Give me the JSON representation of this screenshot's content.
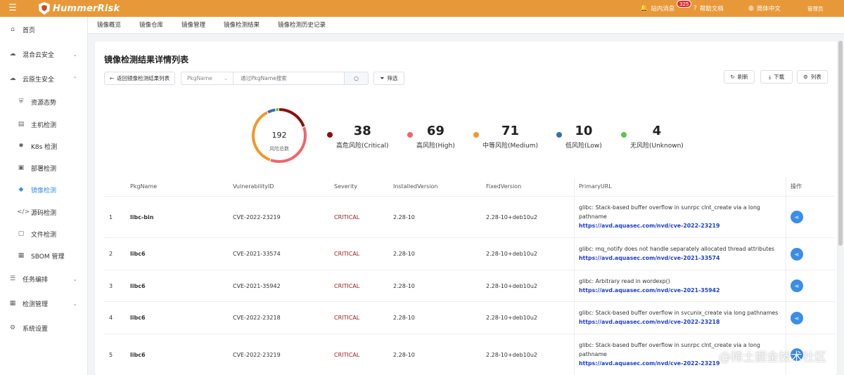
{
  "app": {
    "brand": "HummerRisk"
  },
  "header": {
    "messages_label": "站内消息",
    "messages_badge": "325",
    "help_label": "帮助文档",
    "language_label": "简体中文",
    "user_label": "管理员",
    "accent_color": "#e7993a"
  },
  "sidebar": {
    "items": [
      {
        "label": "首页",
        "icon": "home-icon"
      },
      {
        "label": "混合云安全",
        "icon": "cloud-icon"
      },
      {
        "label": "云原生安全",
        "icon": "cloud-native-icon"
      },
      {
        "label": "资源态势",
        "icon": "shield-icon"
      },
      {
        "label": "主机检测",
        "icon": "server-icon"
      },
      {
        "label": "K8s 检测",
        "icon": "k8s-icon"
      },
      {
        "label": "部署检测",
        "icon": "deploy-icon"
      },
      {
        "label": "镜像检测",
        "icon": "image-icon"
      },
      {
        "label": "源码检测",
        "icon": "code-icon"
      },
      {
        "label": "文件检测",
        "icon": "file-icon"
      },
      {
        "label": "SBOM 管理",
        "icon": "sbom-icon"
      },
      {
        "label": "任务编排",
        "icon": "list-icon"
      },
      {
        "label": "检测管理",
        "icon": "grid-icon"
      },
      {
        "label": "系统设置",
        "icon": "gear-icon"
      }
    ]
  },
  "tabs": [
    "镜像概览",
    "镜像仓库",
    "镜像管理",
    "镜像检测结果",
    "镜像检测历史记录"
  ],
  "main": {
    "title": "镜像检测结果详情列表",
    "back_label": "返回镜像检测结果列表",
    "select_value": "PkgName",
    "search_placeholder": "通过PkgName搜索",
    "filter_label": "筛选",
    "refresh_label": "刷新",
    "download_label": "下载",
    "columns_label": "列表"
  },
  "summary": {
    "total": "192",
    "total_label": "风险总数",
    "stats": [
      {
        "value": "38",
        "label": "高危风险(Critical)",
        "color": "#8b0f0f"
      },
      {
        "value": "69",
        "label": "高风险(High)",
        "color": "#f0646c"
      },
      {
        "value": "71",
        "label": "中等风险(Medium)",
        "color": "#f5962a"
      },
      {
        "value": "10",
        "label": "低风险(Low)",
        "color": "#3d6ea8"
      },
      {
        "value": "4",
        "label": "无风险(Unknown)",
        "color": "#5fc24c"
      }
    ]
  },
  "table": {
    "headers": [
      "PkgName",
      "VulnerabilityID",
      "Severity",
      "InstalledVersion",
      "FixedVersion",
      "PrimaryURL",
      "操作"
    ],
    "rows": [
      {
        "index": "1",
        "pkg": "libc-bin",
        "vuln": "CVE-2022-23219",
        "severity": "CRITICAL",
        "installed": "2.28-10",
        "fixed": "2.28-10+deb10u2",
        "desc": "glibc: Stack-based buffer overflow in sunrpc clnt_create via a long pathname",
        "url": "https://avd.aquasec.com/nvd/cve-2022-23219"
      },
      {
        "index": "2",
        "pkg": "libc6",
        "vuln": "CVE-2021-33574",
        "severity": "CRITICAL",
        "installed": "2.28-10",
        "fixed": "2.28-10+deb10u2",
        "desc": "glibc: mq_notify does not handle separately allocated thread attributes",
        "url": "https://avd.aquasec.com/nvd/cve-2021-33574"
      },
      {
        "index": "3",
        "pkg": "libc6",
        "vuln": "CVE-2021-35942",
        "severity": "CRITICAL",
        "installed": "2.28-10",
        "fixed": "2.28-10+deb10u2",
        "desc": "glibc: Arbitrary read in wordexp()",
        "url": "https://avd.aquasec.com/nvd/cve-2021-35942"
      },
      {
        "index": "4",
        "pkg": "libc6",
        "vuln": "CVE-2022-23218",
        "severity": "CRITICAL",
        "installed": "2.28-10",
        "fixed": "2.28-10+deb10u2",
        "desc": "glibc: Stack-based buffer overflow in svcunix_create via long pathnames",
        "url": "https://avd.aquasec.com/nvd/cve-2022-23218"
      },
      {
        "index": "5",
        "pkg": "libc6",
        "vuln": "CVE-2022-23219",
        "severity": "CRITICAL",
        "installed": "2.28-10",
        "fixed": "2.28-10+deb10u2",
        "desc": "glibc: Stack-based buffer overflow in sunrpc clnt_create via a long pathname",
        "url": "https://avd.aquasec.com/nvd/cve-2022-23219"
      }
    ]
  },
  "watermark": "@稀土掘金技术社区"
}
